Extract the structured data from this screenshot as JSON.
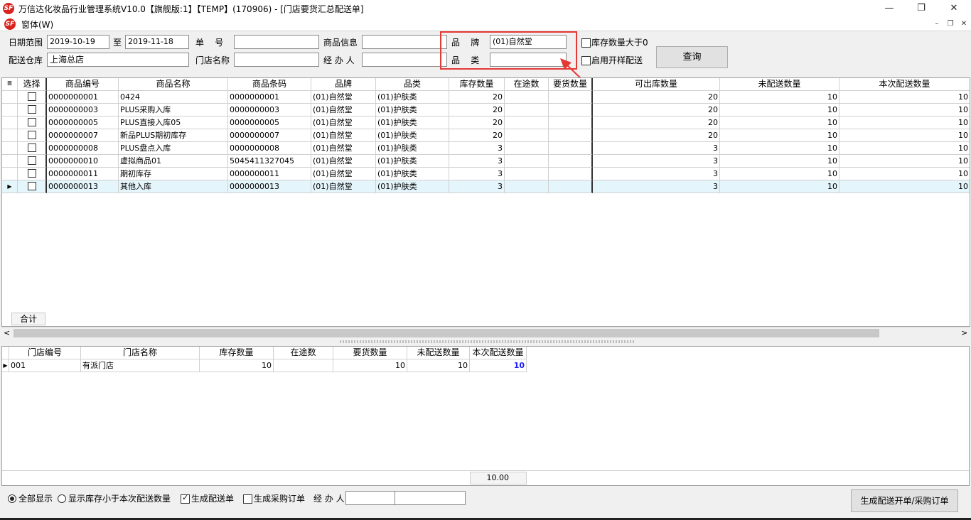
{
  "window": {
    "title": "万信达化妆品行业管理系统V10.0【旗舰版:1】【TEMP】(170906) - [门店要货汇总配送单]",
    "logo": "SF",
    "controls": {
      "minimize": "—",
      "restore": "❐",
      "close": "✕"
    }
  },
  "menu": {
    "window_label": "窗体(W)",
    "mdi_controls": {
      "minimize": "–",
      "restore": "❐",
      "close": "✕"
    }
  },
  "form": {
    "date_range_label": "日期范围",
    "date_from": "2019-10-19",
    "date_to_label": "至",
    "date_to": "2019-11-18",
    "order_no_label": "单    号",
    "order_no": "",
    "product_info_label": "商品信息",
    "product_info": "",
    "brand_label": "品    牌",
    "brand_value": "(01)自然堂",
    "category_label": "品    类",
    "category_value": "",
    "warehouse_label": "配送仓库",
    "warehouse_value": "上海总店",
    "store_name_label": "门店名称",
    "store_name_value": "",
    "handler_label": "经 办 人",
    "handler_value": "",
    "stock_gt_zero_label": "库存数量大于0",
    "sample_dist_label": "启用开样配送",
    "query_button": "查询"
  },
  "top_grid": {
    "columns": [
      "选择",
      "商品编号",
      "商品名称",
      "商品条码",
      "品牌",
      "品类",
      "库存数量",
      "在途数",
      "要货数量",
      "可出库数量",
      "未配送数量",
      "本次配送数量"
    ],
    "rows": [
      {
        "code": "0000000001",
        "name": "0424",
        "barcode": "0000000001",
        "brand": "(01)自然堂",
        "category": "(01)护肤类",
        "stock": "20",
        "transit": "",
        "demand": "",
        "available": "20",
        "undelivered": "10",
        "this_delivery": "10"
      },
      {
        "code": "0000000003",
        "name": "PLUS采购入库",
        "barcode": "0000000003",
        "brand": "(01)自然堂",
        "category": "(01)护肤类",
        "stock": "20",
        "transit": "",
        "demand": "",
        "available": "20",
        "undelivered": "10",
        "this_delivery": "10"
      },
      {
        "code": "0000000005",
        "name": "PLUS直接入库05",
        "barcode": "0000000005",
        "brand": "(01)自然堂",
        "category": "(01)护肤类",
        "stock": "20",
        "transit": "",
        "demand": "",
        "available": "20",
        "undelivered": "10",
        "this_delivery": "10"
      },
      {
        "code": "0000000007",
        "name": "新品PLUS期初库存",
        "barcode": "0000000007",
        "brand": "(01)自然堂",
        "category": "(01)护肤类",
        "stock": "20",
        "transit": "",
        "demand": "",
        "available": "20",
        "undelivered": "10",
        "this_delivery": "10"
      },
      {
        "code": "0000000008",
        "name": "PLUS盘点入库",
        "barcode": "0000000008",
        "brand": "(01)自然堂",
        "category": "(01)护肤类",
        "stock": "3",
        "transit": "",
        "demand": "",
        "available": "3",
        "undelivered": "10",
        "this_delivery": "10"
      },
      {
        "code": "0000000010",
        "name": "虚拟商品01",
        "barcode": "5045411327045",
        "brand": "(01)自然堂",
        "category": "(01)护肤类",
        "stock": "3",
        "transit": "",
        "demand": "",
        "available": "3",
        "undelivered": "10",
        "this_delivery": "10"
      },
      {
        "code": "0000000011",
        "name": "期初库存",
        "barcode": "0000000011",
        "brand": "(01)自然堂",
        "category": "(01)护肤类",
        "stock": "3",
        "transit": "",
        "demand": "",
        "available": "3",
        "undelivered": "10",
        "this_delivery": "10"
      },
      {
        "code": "0000000013",
        "name": "其他入库",
        "barcode": "0000000013",
        "brand": "(01)自然堂",
        "category": "(01)护肤类",
        "stock": "3",
        "transit": "",
        "demand": "",
        "available": "3",
        "undelivered": "10",
        "this_delivery": "10"
      }
    ],
    "selected_row": 7,
    "footer_label": "合计"
  },
  "bottom_grid": {
    "columns": [
      "门店编号",
      "门店名称",
      "库存数量",
      "在途数",
      "要货数量",
      "未配送数量",
      "本次配送数量"
    ],
    "rows": [
      {
        "store_code": "001",
        "store_name": "有派门店",
        "stock": "10",
        "transit": "",
        "demand": "10",
        "undelivered": "10",
        "this_delivery": "10"
      }
    ],
    "total": "10.00"
  },
  "bottom_bar": {
    "show_all_label": "全部显示",
    "show_low_stock_label": "显示库存小于本次配送数量",
    "gen_dist_label": "生成配送单",
    "gen_purchase_label": "生成采购订单",
    "handler_label": "经 办 人",
    "handler_value": "",
    "generate_button": "生成配送开单/采购订单"
  },
  "colors": {
    "highlight": "#e53935",
    "selected_row": "#e4f5fb",
    "emphasis_value": "#1a1aff"
  }
}
